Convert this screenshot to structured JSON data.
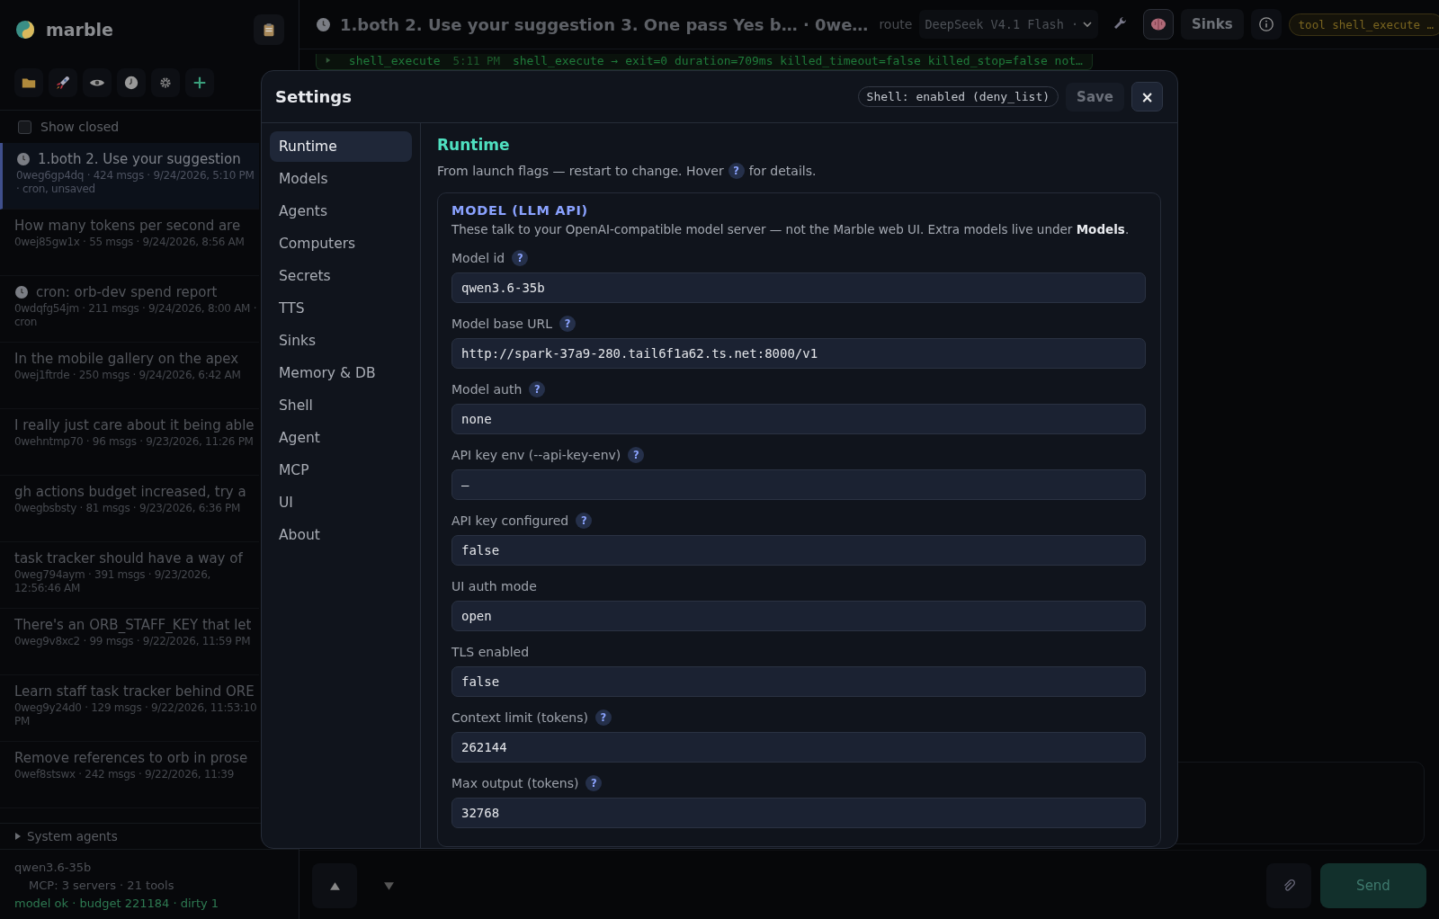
{
  "app": {
    "name": "marble"
  },
  "sidebar": {
    "show_closed": {
      "label": "Show closed",
      "checked": false
    },
    "sessions": [
      {
        "kind": "cron",
        "title": "1.both 2. Use your suggestion",
        "meta": "0weg6gp4dq · 424 msgs · 9/24/2026, 5:10 PM · cron, unsaved",
        "selected": true
      },
      {
        "kind": "chat",
        "title": "How many tokens per second are",
        "meta": "0wej85gw1x · 55 msgs · 9/24/2026, 8:56 AM",
        "selected": false
      },
      {
        "kind": "cron",
        "title": "cron: orb-dev spend report",
        "meta": "0wdqfg54jm · 211 msgs · 9/24/2026, 8:00 AM · cron",
        "selected": false
      },
      {
        "kind": "chat",
        "title": "In the mobile gallery on the apex",
        "meta": "0wej1ftrde · 250 msgs · 9/24/2026, 6:42 AM",
        "selected": false
      },
      {
        "kind": "chat",
        "title": "I really just care about it being able",
        "meta": "0wehntmp70 · 96 msgs · 9/23/2026, 11:26 PM",
        "selected": false
      },
      {
        "kind": "chat",
        "title": "gh actions budget increased, try a",
        "meta": "0wegbsbsty · 81 msgs · 9/23/2026, 6:36 PM",
        "selected": false
      },
      {
        "kind": "chat",
        "title": "task tracker should have a way of",
        "meta": "0weg794aym · 391 msgs · 9/23/2026, 12:56:46 AM",
        "selected": false
      },
      {
        "kind": "chat",
        "title": "There's an ORB_STAFF_KEY that let",
        "meta": "0weg9v8xc2 · 99 msgs · 9/22/2026, 11:59 PM",
        "selected": false
      },
      {
        "kind": "chat",
        "title": "Learn staff task tracker behind ORE",
        "meta": "0weg9y24d0 · 129 msgs · 9/22/2026, 11:53:10 PM",
        "selected": false
      },
      {
        "kind": "chat",
        "title": "Remove references to orb in prose",
        "meta": "0wef8stswx · 242 msgs · 9/22/2026, 11:39",
        "selected": false
      }
    ],
    "system_agents": {
      "label": "System agents",
      "expanded": false
    },
    "footer": {
      "model": "qwen3.6-35b",
      "mcp": "MCP: 3 servers · 21 tools",
      "status": "model ok · budget 221184 · dirty 1"
    }
  },
  "topbar": {
    "title": "1.both 2. Use your suggestion 3. One pass Yes b… · 0we…",
    "route_label": "route",
    "model_select": "DeepSeek V4.1 Flash ·",
    "sinks_button": "Sinks",
    "tool_pill": "tool shell_execute …"
  },
  "log_line": {
    "tool": "shell_execute",
    "time": "5:11 PM",
    "text": "shell_execute → exit=0 duration=709ms killed_timeout=false killed_stop=false not…"
  },
  "composer": {
    "send_button": "Send"
  },
  "settings": {
    "title": "Settings",
    "shell_pill": "Shell: enabled (deny_list)",
    "save_button": "Save",
    "close_button": "×",
    "nav": [
      {
        "label": "Runtime",
        "selected": true
      },
      {
        "label": "Models",
        "selected": false
      },
      {
        "label": "Agents",
        "selected": false
      },
      {
        "label": "Computers",
        "selected": false
      },
      {
        "label": "Secrets",
        "selected": false
      },
      {
        "label": "TTS",
        "selected": false
      },
      {
        "label": "Sinks",
        "selected": false
      },
      {
        "label": "Memory & DB",
        "selected": false
      },
      {
        "label": "Shell",
        "selected": false
      },
      {
        "label": "Agent",
        "selected": false
      },
      {
        "label": "MCP",
        "selected": false
      },
      {
        "label": "UI",
        "selected": false
      },
      {
        "label": "About",
        "selected": false
      }
    ],
    "heading": "Runtime",
    "desc_before": "From launch flags — restart to change. Hover",
    "desc_help": "?",
    "desc_after": "for details.",
    "section": {
      "heading": "MODEL (LLM API)",
      "desc": "These talk to your OpenAI-compatible model server — not the Marble web UI. Extra models live under **Models**.",
      "fields": [
        {
          "label": "Model id",
          "help": "?",
          "value": "qwen3.6-35b"
        },
        {
          "label": "Model base URL",
          "help": "?",
          "value": "http://spark-37a9-280.tail6f1a62.ts.net:8000/v1"
        },
        {
          "label": "Model auth",
          "help": "?",
          "value": "none"
        },
        {
          "label": "API key env (--api-key-env)",
          "help": "?",
          "value": "—"
        },
        {
          "label": "API key configured",
          "help": "?",
          "value": "false"
        },
        {
          "label": "UI auth mode",
          "value": "open"
        },
        {
          "label": "TLS enabled",
          "value": "false"
        },
        {
          "label": "Context limit (tokens)",
          "help": "?",
          "value": "262144"
        },
        {
          "label": "Max output (tokens)",
          "help": "?",
          "value": "32768"
        }
      ]
    }
  }
}
